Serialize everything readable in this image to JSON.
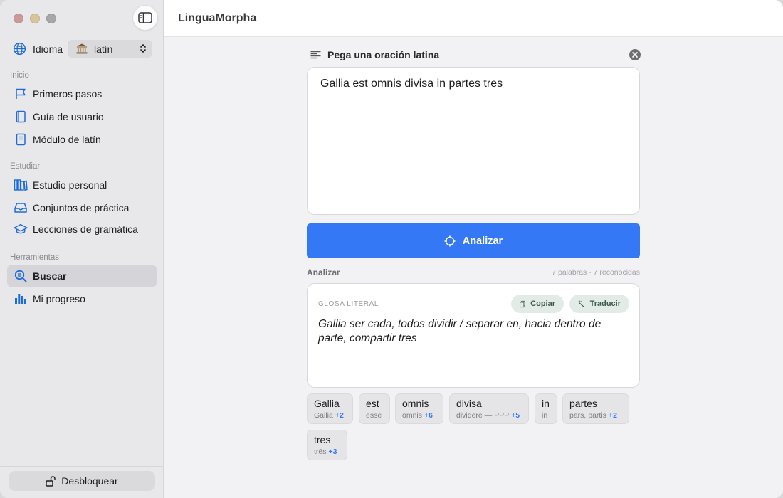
{
  "app": {
    "title": "LinguaMorpha"
  },
  "colors": {
    "accent": "#3478f6",
    "sidebar_bg": "#e8e8ea",
    "main_bg": "#f2f2f5"
  },
  "sidebar": {
    "language": {
      "label": "Idioma",
      "value": "latín",
      "icon": "globe-icon",
      "value_icon": "temple-icon"
    },
    "sections": [
      {
        "label": "Inicio",
        "items": [
          {
            "label": "Primeros pasos",
            "icon": "flag-icon"
          },
          {
            "label": "Guía de usuario",
            "icon": "book-icon"
          },
          {
            "label": "Módulo de latín",
            "icon": "book-closed-icon"
          }
        ]
      },
      {
        "label": "Estudiar",
        "items": [
          {
            "label": "Estudio personal",
            "icon": "books-icon"
          },
          {
            "label": "Conjuntos de práctica",
            "icon": "tray-icon"
          },
          {
            "label": "Lecciones de gramática",
            "icon": "graduation-cap-icon"
          }
        ]
      },
      {
        "label": "Herramientas",
        "items": [
          {
            "label": "Buscar",
            "icon": "search-text-icon",
            "active": true
          },
          {
            "label": "Mi progreso",
            "icon": "bar-chart-icon"
          }
        ]
      }
    ],
    "unlock_label": "Desbloquear"
  },
  "input": {
    "header": "Pega una oración latina",
    "value": "Gallia est omnis divisa in partes tres"
  },
  "analyze_button": "Analizar",
  "result": {
    "label": "Analizar",
    "count": "7 palabras · 7 reconocidas",
    "gloss_title": "GLOSA LITERAL",
    "copy_label": "Copiar",
    "translate_label": "Traducir",
    "gloss_text": "Gallia ser cada, todos dividir / separar en, hacia dentro de parte, compartir tres"
  },
  "tokens": [
    {
      "word": "Gallia",
      "lemma": "Gallia",
      "more": "+2"
    },
    {
      "word": "est",
      "lemma": "esse",
      "more": ""
    },
    {
      "word": "omnis",
      "lemma": "omnis",
      "more": "+6"
    },
    {
      "word": "divisa",
      "lemma": "dividere — PPP",
      "more": "+5"
    },
    {
      "word": "in",
      "lemma": "in",
      "more": ""
    },
    {
      "word": "partes",
      "lemma": "pars, partis",
      "more": "+2"
    },
    {
      "word": "tres",
      "lemma": "trēs",
      "more": "+3"
    }
  ]
}
